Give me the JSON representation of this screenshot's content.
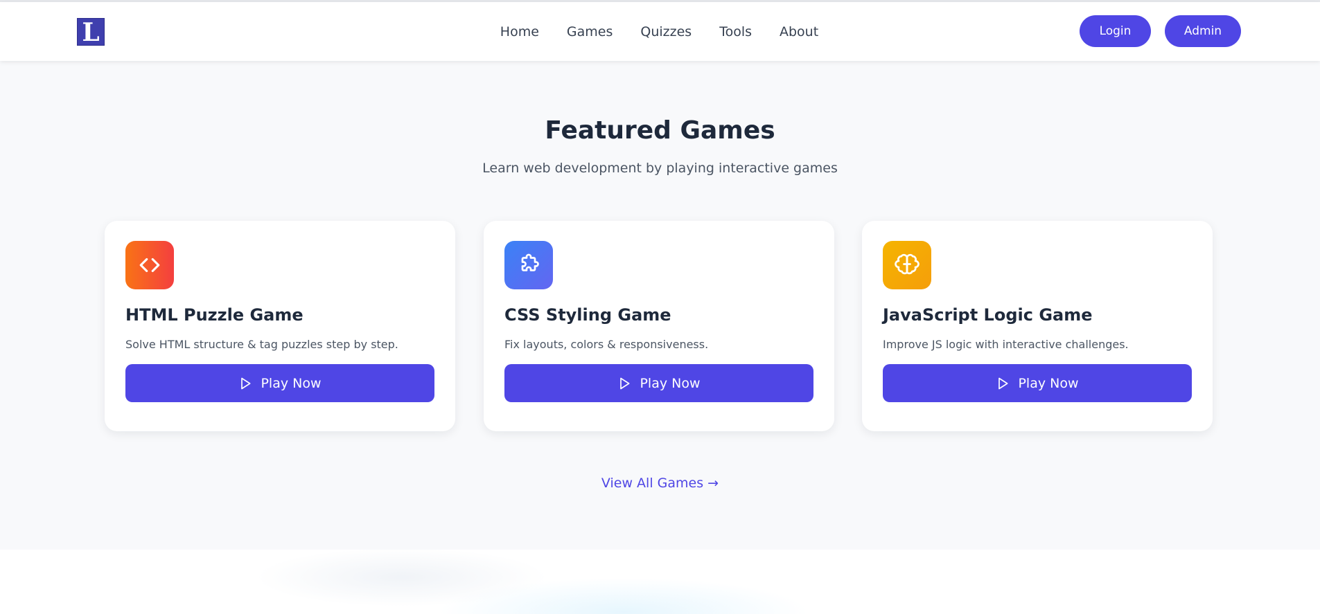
{
  "header": {
    "logo_letter": "L",
    "nav": [
      "Home",
      "Games",
      "Quizzes",
      "Tools",
      "About"
    ],
    "login_label": "Login",
    "admin_label": "Admin"
  },
  "featured": {
    "title": "Featured Games",
    "subtitle": "Learn web development by playing interactive games",
    "cards": [
      {
        "icon": "code-icon",
        "title": "HTML Puzzle Game",
        "description": "Solve HTML structure & tag puzzles step by step.",
        "button_label": "Play Now"
      },
      {
        "icon": "puzzle-icon",
        "title": "CSS Styling Game",
        "description": "Fix layouts, colors & responsiveness.",
        "button_label": "Play Now"
      },
      {
        "icon": "brain-icon",
        "title": "JavaScript Logic Game",
        "description": "Improve JS logic with interactive challenges.",
        "button_label": "Play Now"
      }
    ],
    "view_all_label": "View All Games →"
  },
  "colors": {
    "primary": "#4f46e5",
    "html_icon": "#f97316",
    "css_icon": "#3b82f6",
    "js_icon": "#f59e0b"
  }
}
